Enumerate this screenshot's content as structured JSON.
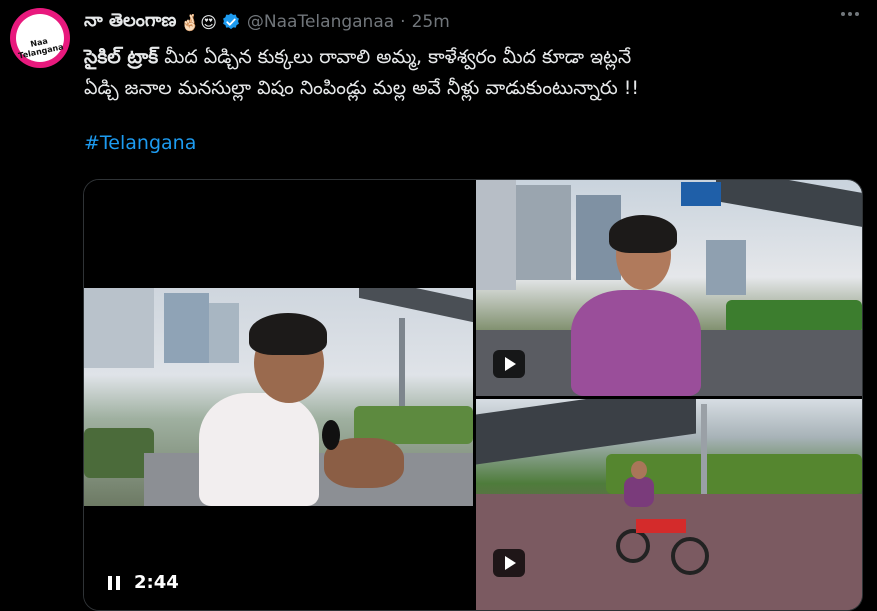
{
  "tweet": {
    "author_name": "నా తెలంగాణ",
    "author_emojis": "🤞🏻😍",
    "handle": "@NaaTelanganaa",
    "separator": "·",
    "time": "25m",
    "avatar_text": "Naa Telangana",
    "text_bold": "సైకిల్ ట్రాక్",
    "text_line1_rest": " మీద ఏడ్చిన కుక్కలు రావాలి అమ్మ, కాళేశ్వరం మీద కూడా ఇట్లనే",
    "text_line2": "ఏడ్చి జనాల మనసుల్లా విషం నింపిండ్లు మల్ల అవే నీళ్లు వాడుకుంటున్నారు !!",
    "hashtag": "#Telangana"
  },
  "media": {
    "video_duration": "2:44"
  },
  "colors": {
    "background": "#000000",
    "text": "#e7e9ea",
    "muted": "#71767b",
    "link": "#1d9bf0",
    "verified": "#1d9bf0",
    "avatar": "#e8197d"
  },
  "icons": [
    "verified-badge-icon",
    "more-icon",
    "play-icon",
    "pause-icon"
  ]
}
